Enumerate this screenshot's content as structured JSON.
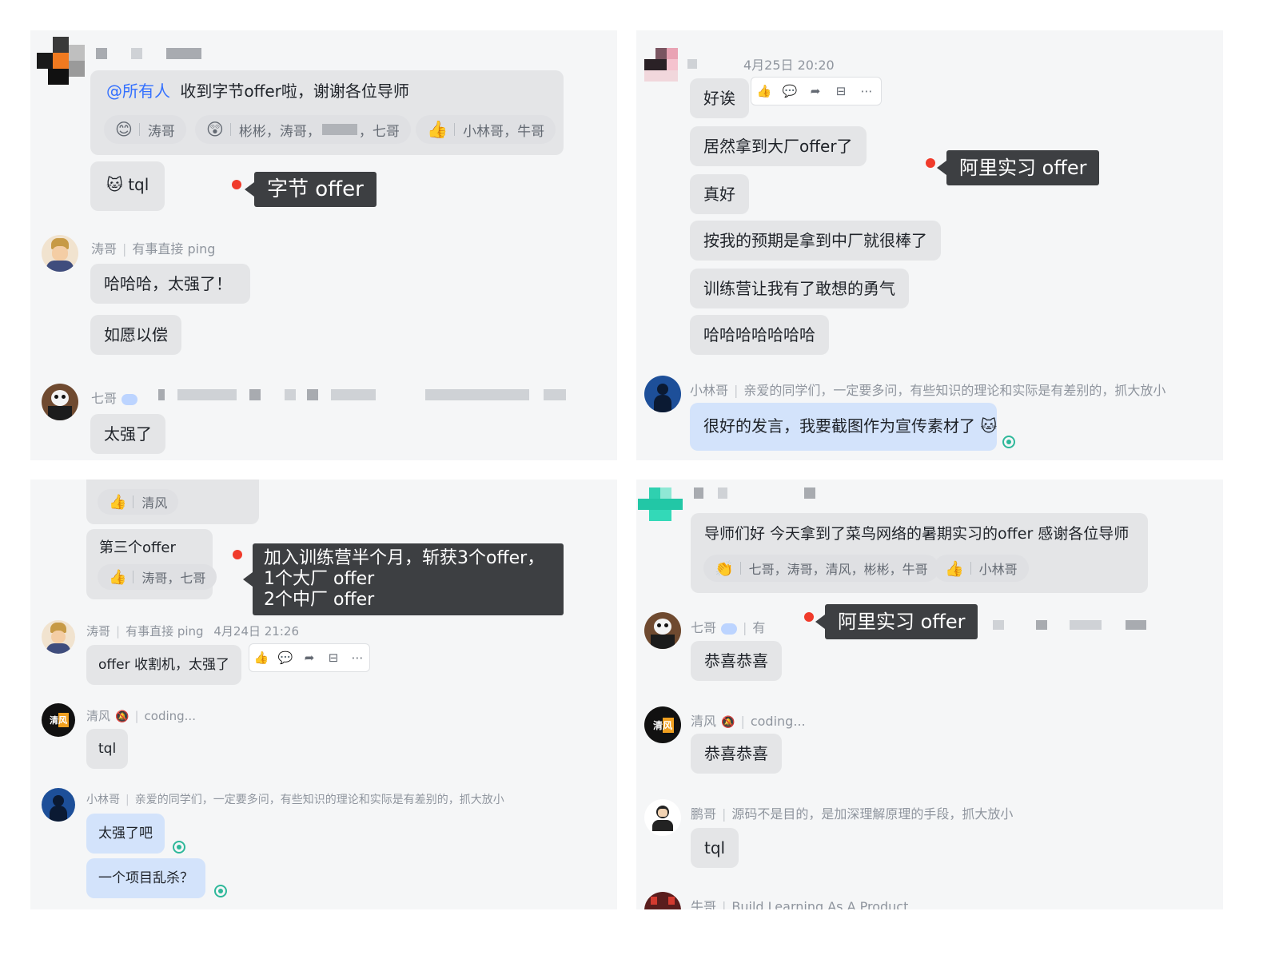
{
  "p1": {
    "mention": "@所有人",
    "msg1": "收到字节offer啦，谢谢各位导师",
    "reactions": [
      {
        "emoji": "😊",
        "users": "涛哥"
      },
      {
        "emoji": "😲",
        "users": "彬彬，涛哥，",
        "users2": "，七哥"
      },
      {
        "emoji": "👍",
        "users": "小林哥，牛哥"
      }
    ],
    "tql_emoji": "🐱",
    "tql": "tql",
    "callout": "字节 offer",
    "taoge_name": "涛哥",
    "taoge_sig": "有事直接 ping",
    "msg2": "哈哈哈，太强了！",
    "msg3": "如愿以偿",
    "qige_name": "七哥",
    "msg4": "太强了"
  },
  "p2": {
    "time": "4月25日 20:20",
    "msgs": [
      "好诶",
      "居然拿到大厂offer了",
      "真好",
      "按我的预期是拿到中厂就很棒了",
      "训练营让我有了敢想的勇气",
      "哈哈哈哈哈哈哈"
    ],
    "toolbar": [
      "👍",
      "💬",
      "➦",
      "⊟",
      "⋯"
    ],
    "callout": "阿里实习 offer",
    "xlg_name": "小林哥",
    "xlg_sig": "亲爱的同学们，一定要多问，有些知识的理论和实际是有差别的，抓大放小",
    "xlg_msg": "很好的发言，我要截图作为宣传素材了",
    "xlg_emoji": "🐱"
  },
  "p3": {
    "r1_emoji": "👍",
    "r1_users": "清风",
    "msg1": "第三个offer",
    "r2_emoji": "👍",
    "r2_users": "涛哥，七哥",
    "callout_lines": [
      "加入训练营半个月，斩获3个offer，",
      "1个大厂 offer",
      "2个中厂 offer"
    ],
    "taoge_name": "涛哥",
    "taoge_sig": "有事直接 ping",
    "taoge_time": "4月24日 21:26",
    "msg2": "offer 收割机，太强了",
    "toolbar": [
      "👍",
      "💬",
      "➦",
      "⊟",
      "⋯"
    ],
    "qf_avatar": "清风",
    "qf_name": "清风",
    "qf_sig": "coding...",
    "msg3": "tql",
    "xlg_name": "小林哥",
    "xlg_sig": "亲爱的同学们，一定要多问，有些知识的理论和实际是有差别的，抓大放小",
    "msg4": "太强了吧",
    "msg5": "一个项目乱杀？"
  },
  "p4": {
    "msg1": "导师们好 今天拿到了菜鸟网络的暑期实习的offer 感谢各位导师",
    "r1_emoji": "👏",
    "r1_users": "七哥，涛哥，清风，彬彬，牛哥",
    "r2_emoji": "👍",
    "r2_users": "小林哥",
    "qige_name": "七哥",
    "qige_sig_frag": "有",
    "callout": "阿里实习 offer",
    "msg2": "恭喜恭喜",
    "qf_avatar": "清风",
    "qf_name": "清风",
    "qf_sig": "coding...",
    "msg3": "恭喜恭喜",
    "pg_name": "鹏哥",
    "pg_sig": "源码不是目的，是加深理解原理的手段，抓大放小",
    "msg4": "tql",
    "ng_name": "牛哥",
    "ng_sig": "Build Learning As A Product"
  },
  "colors": {
    "accent_mention": "#3370ff",
    "callout_bg": "#3d3f42",
    "dot": "#f03b2b",
    "bubble": "#e4e5e7",
    "bubble_blue": "#d3e3fb",
    "read": "#2eb89a"
  }
}
